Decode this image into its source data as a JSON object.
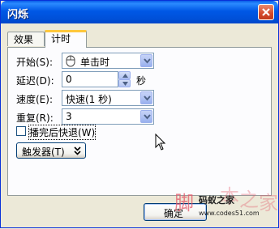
{
  "window": {
    "title": "闪烁"
  },
  "tabs": [
    {
      "label": "效果"
    },
    {
      "label": "计时"
    }
  ],
  "form": {
    "start": {
      "label": "开始(S):",
      "value": "单击时",
      "icon": "mouse-icon"
    },
    "delay": {
      "label": "延迟(D):",
      "value": "0",
      "unit": "秒"
    },
    "speed": {
      "label": "速度(E):",
      "value": "快速(1 秒)"
    },
    "repeat": {
      "label": "重复(R):",
      "value": "3"
    },
    "rewind": {
      "label": "播完后快退(W)",
      "checked": false
    },
    "trigger": {
      "label": "触发器(T)"
    }
  },
  "buttons": {
    "ok": "确定"
  },
  "watermark": {
    "glyphs": [
      "脚",
      "本",
      "之",
      "家"
    ],
    "site": "码蚁之家",
    "url": "www.codes51.com"
  },
  "colors": {
    "titlebar": "#0058e6",
    "active_tab_accent": "#ffc83c",
    "field_border": "#7f9db9"
  }
}
